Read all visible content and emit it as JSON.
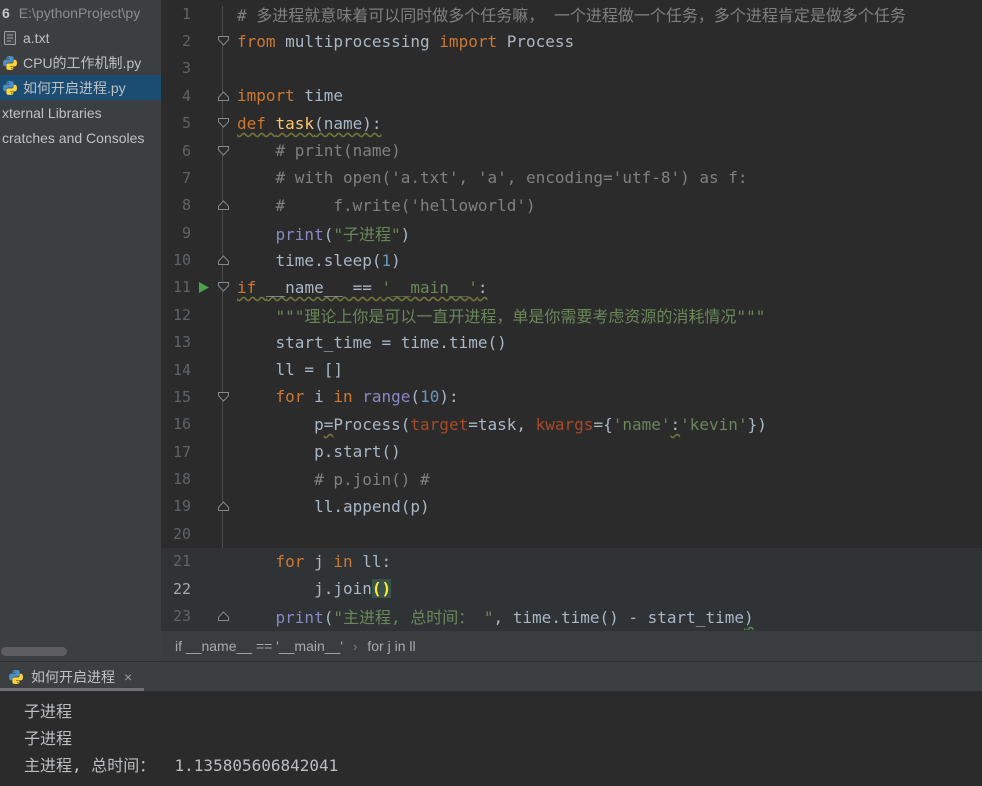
{
  "colors": {
    "panel_bg": "#3c3f41",
    "editor_bg": "#2b2b2b",
    "selection_blue": "#1b4c72",
    "keyword_orange": "#cc7832",
    "string_green": "#6a8759",
    "comment_gray": "#808080",
    "number_blue": "#6897bb",
    "builtin_purple": "#8888c6",
    "funcdef_yellow": "#ffc66d",
    "kwarg_rust": "#aa4926",
    "run_green": "#4da150",
    "brace_match_yellow": "#ffef28"
  },
  "project_panel": {
    "root": {
      "name": "6",
      "path": "E:\\pythonProject\\py"
    },
    "items": [
      {
        "label": "a.txt",
        "icon": "text-file"
      },
      {
        "label": "CPU的工作机制.py",
        "icon": "python-file"
      },
      {
        "label": "如何开启进程.py",
        "icon": "python-file",
        "selected": true
      },
      {
        "label": "xternal Libraries",
        "icon": null
      },
      {
        "label": "cratches and Consoles",
        "icon": null
      }
    ]
  },
  "editor": {
    "lines": [
      {
        "n": 1,
        "tokens": [
          {
            "t": "# 多进程就意味着可以同时做多个任务嘛， 一个进程做一个任务，多个进程肯定是做多个任务",
            "c": "com"
          }
        ]
      },
      {
        "n": 2,
        "fold": "down",
        "tokens": [
          {
            "t": "from",
            "c": "kw"
          },
          {
            "t": " multiprocessing ",
            "c": "def"
          },
          {
            "t": "import",
            "c": "kw"
          },
          {
            "t": " Process",
            "c": "def"
          }
        ]
      },
      {
        "n": 3,
        "tokens": []
      },
      {
        "n": 4,
        "fold": "up",
        "tokens": [
          {
            "t": "import",
            "c": "kw"
          },
          {
            "t": " time",
            "c": "def"
          }
        ]
      },
      {
        "n": 5,
        "fold": "down",
        "wavy": true,
        "tokens": [
          {
            "t": "def ",
            "c": "kw"
          },
          {
            "t": "task",
            "c": "fn"
          },
          {
            "t": "(name):",
            "c": "def"
          }
        ]
      },
      {
        "n": 6,
        "fold": "down",
        "tokens": [
          {
            "t": "    # print(name)",
            "c": "com"
          }
        ]
      },
      {
        "n": 7,
        "tokens": [
          {
            "t": "    # with open('a.txt', 'a', encoding='utf-8') as f:",
            "c": "com"
          }
        ]
      },
      {
        "n": 8,
        "fold": "up",
        "tokens": [
          {
            "t": "    #     f.write('helloworld')",
            "c": "com"
          }
        ]
      },
      {
        "n": 9,
        "tokens": [
          {
            "t": "    ",
            "c": "def"
          },
          {
            "t": "print",
            "c": "bi"
          },
          {
            "t": "(",
            "c": "def"
          },
          {
            "t": "\"子进程\"",
            "c": "str"
          },
          {
            "t": ")",
            "c": "def"
          }
        ]
      },
      {
        "n": 10,
        "fold": "up",
        "tokens": [
          {
            "t": "    time.sleep(",
            "c": "def"
          },
          {
            "t": "1",
            "c": "num"
          },
          {
            "t": ")",
            "c": "def"
          }
        ]
      },
      {
        "n": 11,
        "fold": "down",
        "run": true,
        "wavy": true,
        "tokens": [
          {
            "t": "if ",
            "c": "kw"
          },
          {
            "t": "__name__ == ",
            "c": "def"
          },
          {
            "t": "'__main__'",
            "c": "str"
          },
          {
            "t": ":",
            "c": "def"
          }
        ]
      },
      {
        "n": 12,
        "tokens": [
          {
            "t": "    ",
            "c": "def"
          },
          {
            "t": "\"\"\"理论上你是可以一直开进程，单是你需要考虑资源的消耗情况\"\"\"",
            "c": "str"
          }
        ]
      },
      {
        "n": 13,
        "tokens": [
          {
            "t": "    start_time = time.time()",
            "c": "def"
          }
        ]
      },
      {
        "n": 14,
        "tokens": [
          {
            "t": "    ll = []",
            "c": "def"
          }
        ]
      },
      {
        "n": 15,
        "fold": "down",
        "tokens": [
          {
            "t": "    ",
            "c": "def"
          },
          {
            "t": "for",
            "c": "kw"
          },
          {
            "t": " i ",
            "c": "def"
          },
          {
            "t": "in",
            "c": "kw"
          },
          {
            "t": " ",
            "c": "def"
          },
          {
            "t": "range",
            "c": "bi"
          },
          {
            "t": "(",
            "c": "def"
          },
          {
            "t": "10",
            "c": "num"
          },
          {
            "t": "):",
            "c": "def"
          }
        ]
      },
      {
        "n": 16,
        "tokens": [
          {
            "t": "        p",
            "c": "def"
          },
          {
            "t": "=",
            "c": "def",
            "w": "olive"
          },
          {
            "t": "Process(",
            "c": "def"
          },
          {
            "t": "target",
            "c": "kwarg"
          },
          {
            "t": "=task, ",
            "c": "def"
          },
          {
            "t": "kwargs",
            "c": "kwarg"
          },
          {
            "t": "={",
            "c": "def"
          },
          {
            "t": "'name'",
            "c": "str"
          },
          {
            "t": ":",
            "c": "def",
            "w": "olive"
          },
          {
            "t": "'kevin'",
            "c": "str"
          },
          {
            "t": "})",
            "c": "def"
          }
        ]
      },
      {
        "n": 17,
        "tokens": [
          {
            "t": "        p.start()",
            "c": "def"
          }
        ]
      },
      {
        "n": 18,
        "tokens": [
          {
            "t": "        # p.join() #",
            "c": "com"
          }
        ]
      },
      {
        "n": 19,
        "fold": "up",
        "tokens": [
          {
            "t": "        ll.append(p)",
            "c": "def"
          }
        ]
      },
      {
        "n": 20,
        "tokens": []
      },
      {
        "n": 21,
        "hl": true,
        "tokens": [
          {
            "t": "    ",
            "c": "def"
          },
          {
            "t": "for",
            "c": "kw"
          },
          {
            "t": " j ",
            "c": "def"
          },
          {
            "t": "in",
            "c": "kw"
          },
          {
            "t": " ll:",
            "c": "def"
          }
        ]
      },
      {
        "n": 22,
        "hl": true,
        "cur": true,
        "tokens": [
          {
            "t": "        j.join",
            "c": "def"
          },
          {
            "t": "()",
            "c": "brace"
          }
        ]
      },
      {
        "n": 23,
        "fold": "up",
        "hl": true,
        "tokens": [
          {
            "t": "    ",
            "c": "def"
          },
          {
            "t": "print",
            "c": "bi"
          },
          {
            "t": "(",
            "c": "def"
          },
          {
            "t": "\"主进程, 总时间： \"",
            "c": "str"
          },
          {
            "t": ", time.time() - start_time",
            "c": "def"
          },
          {
            "t": ")",
            "c": "def",
            "w": "green"
          }
        ]
      }
    ]
  },
  "breadcrumb": {
    "separator": "›",
    "items": [
      "if __name__ == '__main__'",
      "for j in ll"
    ]
  },
  "console": {
    "tab": {
      "label": "如何开启进程",
      "close_label": "×"
    },
    "output": [
      "子进程",
      "子进程",
      "主进程, 总时间：  1.135805606842041"
    ]
  }
}
